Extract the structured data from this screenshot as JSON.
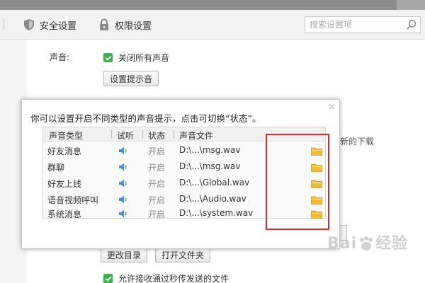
{
  "toolbar": {
    "security_label": "安全设置",
    "permission_label": "权限设置",
    "search_placeholder": "搜索设置项"
  },
  "settings": {
    "sound_label": "声音:",
    "mute_all_label": "关闭所有声音",
    "set_tone_button": "设置提示音",
    "background_tail_text": "新的下载",
    "change_dir_button": "更改目录",
    "open_folder_button": "打开文件夹",
    "allow_flash_transfer_label": "允许接收通过秒传发送的文件"
  },
  "dialog": {
    "description": "你可以设置开启不同类型的声音提示，点击可切换“状态”。",
    "close_glyph": "×",
    "columns": [
      "声音类型",
      "试听",
      "状态",
      "声音文件"
    ],
    "rows": [
      {
        "type": "好友消息",
        "status": "开启",
        "file": "D:\\...\\msg.wav"
      },
      {
        "type": "群聊",
        "status": "开启",
        "file": "D:\\...\\msg.wav"
      },
      {
        "type": "好友上线",
        "status": "开启",
        "file": "D:\\...\\Global.wav"
      },
      {
        "type": "语音视频呼叫",
        "status": "开启",
        "file": "D:\\...\\Audio.wav"
      },
      {
        "type": "系统消息",
        "status": "开启",
        "file": "D:\\...\\system.wav"
      }
    ]
  },
  "watermark": {
    "text": "Bai",
    "text2": "经验"
  },
  "icons": {
    "shield": "shield-icon",
    "lock": "lock-icon",
    "search": "search-icon",
    "speaker": "speaker-icon",
    "folder": "folder-icon",
    "check": "checkbox-checked-icon"
  },
  "colors": {
    "checkbox_green": "#3db24b",
    "speaker_blue": "#4a8fd6",
    "folder_yellow": "#f5b93a",
    "annotation_red": "#e0282e"
  }
}
